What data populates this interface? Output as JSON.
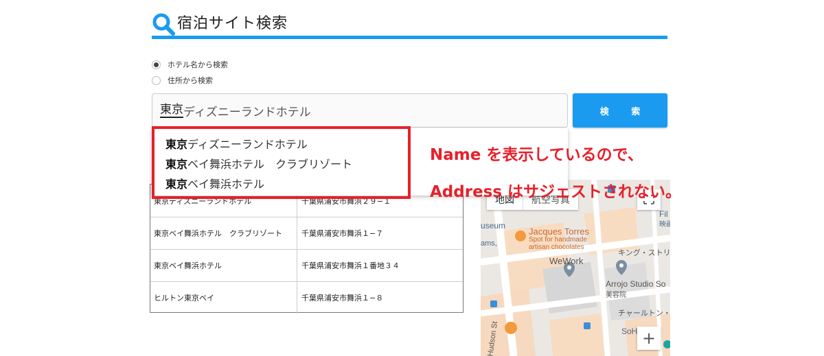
{
  "header": {
    "title": "宿泊サイト検索",
    "icon": "search-icon",
    "accent_color": "#1a9bf0"
  },
  "search_mode": {
    "options": [
      {
        "label": "ホテル名から検索",
        "checked": true
      },
      {
        "label": "住所から検索",
        "checked": false
      }
    ]
  },
  "search": {
    "typed": "東京",
    "completion": "ディズニーランドホテル",
    "button_label": "検 索"
  },
  "suggestions": [
    {
      "match": "東京",
      "rest": "ディズニーランドホテル"
    },
    {
      "match": "東京",
      "rest": "ベイ舞浜ホテル　クラブリゾート"
    },
    {
      "match": "東京",
      "rest": "ベイ舞浜ホテル"
    }
  ],
  "results": [
    {
      "name": "東京ディズニーランドホテル",
      "address": "千葉県浦安市舞浜２９−１"
    },
    {
      "name": "東京ベイ舞浜ホテル　クラブリゾート",
      "address": "千葉県浦安市舞浜１−７"
    },
    {
      "name": "東京ベイ舞浜ホテル",
      "address": "千葉県浦安市舞浜１番地３４"
    },
    {
      "name": "ヒルトン東京ベイ",
      "address": "千葉県浦安市舞浜１−８"
    }
  ],
  "map": {
    "type_map": "地図",
    "type_satellite": "航空写真",
    "labels": {
      "museum": "useum",
      "jacques": "Jacques Torres",
      "jacques_sub1": "Spot for handmade",
      "jacques_sub2": "artisan chocolates",
      "wework": "WeWork",
      "arrojo": "Arrojo Studio So",
      "biyoin": "美容院",
      "king_st": "キング・ストリー",
      "charlton_st": "チャールトン・ス",
      "hudson_st": "Hudson St",
      "soh": "SoH",
      "fil": "Fil",
      "eiga": "映画",
      "ams": "ams,"
    },
    "zoom_in": "+"
  },
  "annotation": {
    "line1": "Name を表示しているので、",
    "line2": "Address はサジェストされない。",
    "color": "#e8202a"
  }
}
